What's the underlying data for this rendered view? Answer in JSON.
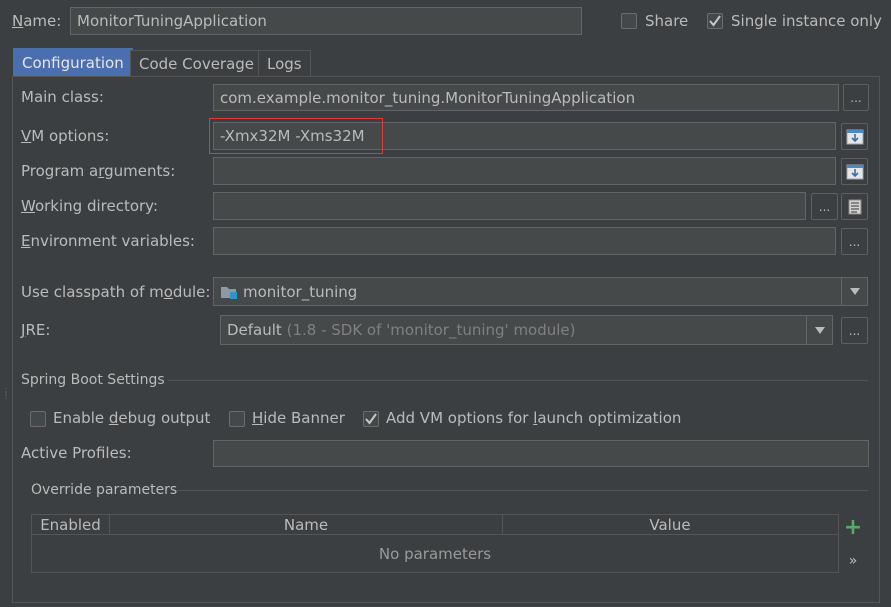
{
  "header": {
    "name_label": "Name:",
    "name_value": "MonitorTuningApplication",
    "share_label": "Share",
    "share_checked": false,
    "single_instance_label": "Single instance only",
    "single_instance_checked": true
  },
  "tabs": [
    {
      "label": "Configuration",
      "active": true
    },
    {
      "label": "Code Coverage",
      "active": false
    },
    {
      "label": "Logs",
      "active": false
    }
  ],
  "form": {
    "main_class_label": "Main class:",
    "main_class_value": "com.example.monitor_tuning.MonitorTuningApplication",
    "vm_options_label": "VM options:",
    "vm_options_value": "-Xmx32M -Xms32M",
    "program_args_label": "Program arguments:",
    "program_args_value": "",
    "working_dir_label": "Working directory:",
    "working_dir_value": "",
    "env_vars_label": "Environment variables:",
    "env_vars_value": "",
    "classpath_label": "Use classpath of module:",
    "classpath_value": "monitor_tuning",
    "jre_label": "JRE:",
    "jre_value": "Default",
    "jre_detail": "(1.8 - SDK of 'monitor_tuning' module)",
    "browse_button": "..."
  },
  "spring_boot": {
    "section_title": "Spring Boot Settings",
    "debug_label": "Enable debug output",
    "debug_checked": false,
    "hide_banner_label": "Hide Banner",
    "hide_banner_checked": false,
    "vm_launch_label": "Add VM options for launch optimization",
    "vm_launch_checked": true,
    "active_profiles_label": "Active Profiles:",
    "active_profiles_value": ""
  },
  "override": {
    "section_title": "Override parameters",
    "columns": [
      "Enabled",
      "Name",
      "Value"
    ],
    "empty_text": "No parameters",
    "add_icon": "+",
    "more_icon": "»"
  },
  "colors": {
    "background": "#3c3f41",
    "field": "#45494a",
    "active_tab": "#4b6eaf",
    "highlight_border": "#e0393a",
    "add_green": "#59a869"
  }
}
